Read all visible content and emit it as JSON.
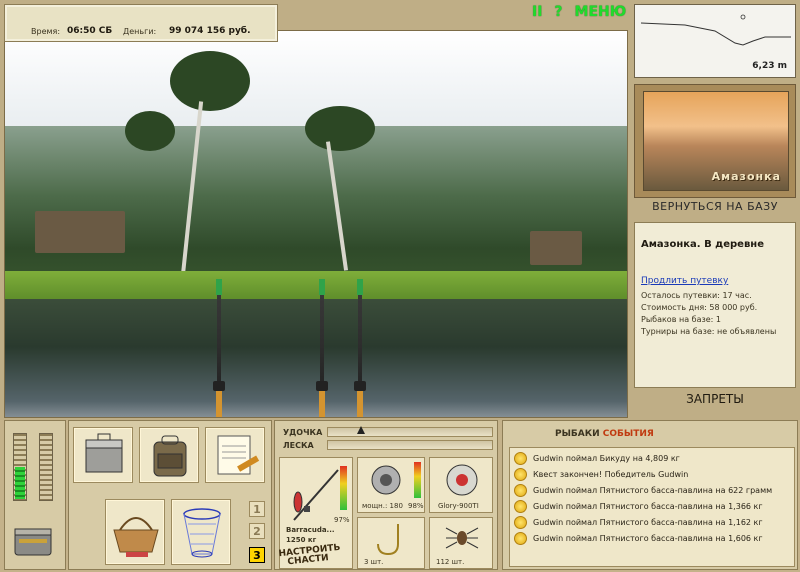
{
  "status": {
    "time_label": "Время:",
    "time_value": "06:50 СБ",
    "money_label": "Деньги:",
    "money_value": "99 074 156 руб."
  },
  "top_controls": {
    "pause": "II",
    "help": "?",
    "menu": "МЕНЮ"
  },
  "depth_map": {
    "depth_value": "6,23 m"
  },
  "location": {
    "card_name": "Амазонка",
    "return_button": "ВЕРНУТЬСЯ НА БАЗУ",
    "place_title": "Амазонка. В деревне",
    "extend_link": "Продлить путевку",
    "rows": [
      "Осталось путевки: 17 час.",
      "Стоимость дня: 58 000 руб.",
      "Рыбаков на базе: 1",
      "Турниры на базе: не объявлены"
    ],
    "bans_button": "ЗАПРЕТЫ"
  },
  "meters": {
    "left_fill": 0.48,
    "right_fill": 0
  },
  "inventory": {
    "slot_numbers": [
      "1",
      "2",
      "3"
    ],
    "active_slot": "3"
  },
  "tackle": {
    "rod_label": "УДОЧКА",
    "line_label": "ЛЕСКА",
    "rod_name": "Barracuda...",
    "rod_weight": "1250 кг",
    "rod_percent": "97%",
    "reel_power": "мощн.: 180",
    "reel_percent": "98%",
    "line_name": "Glory-900TI",
    "hook_count": "3 шт.",
    "bait_count": "112 шт.",
    "setup_button_line1": "НАСТРОИТЬ",
    "setup_button_line2": "СНАСТИ"
  },
  "events": {
    "tab_fishers": "РЫБАКИ",
    "tab_events": "СОБЫТИЯ",
    "items": [
      "Gudwin поймал Бикуду на 4,809 кг",
      "Квест закончен! Победитель Gudwin",
      "Gudwin поймал Пятнистого басса-павлина на 622 грамм",
      "Gudwin поймал Пятнистого басса-павлина на 1,366 кг",
      "Gudwin поймал Пятнистого басса-павлина на 1,162 кг",
      "Gudwin поймал Пятнистого басса-павлина на 1,606 кг"
    ]
  },
  "colors": {
    "accent_green": "#1fdc2c",
    "link_blue": "#1a3ab8",
    "active_slot": "#ffd400"
  }
}
